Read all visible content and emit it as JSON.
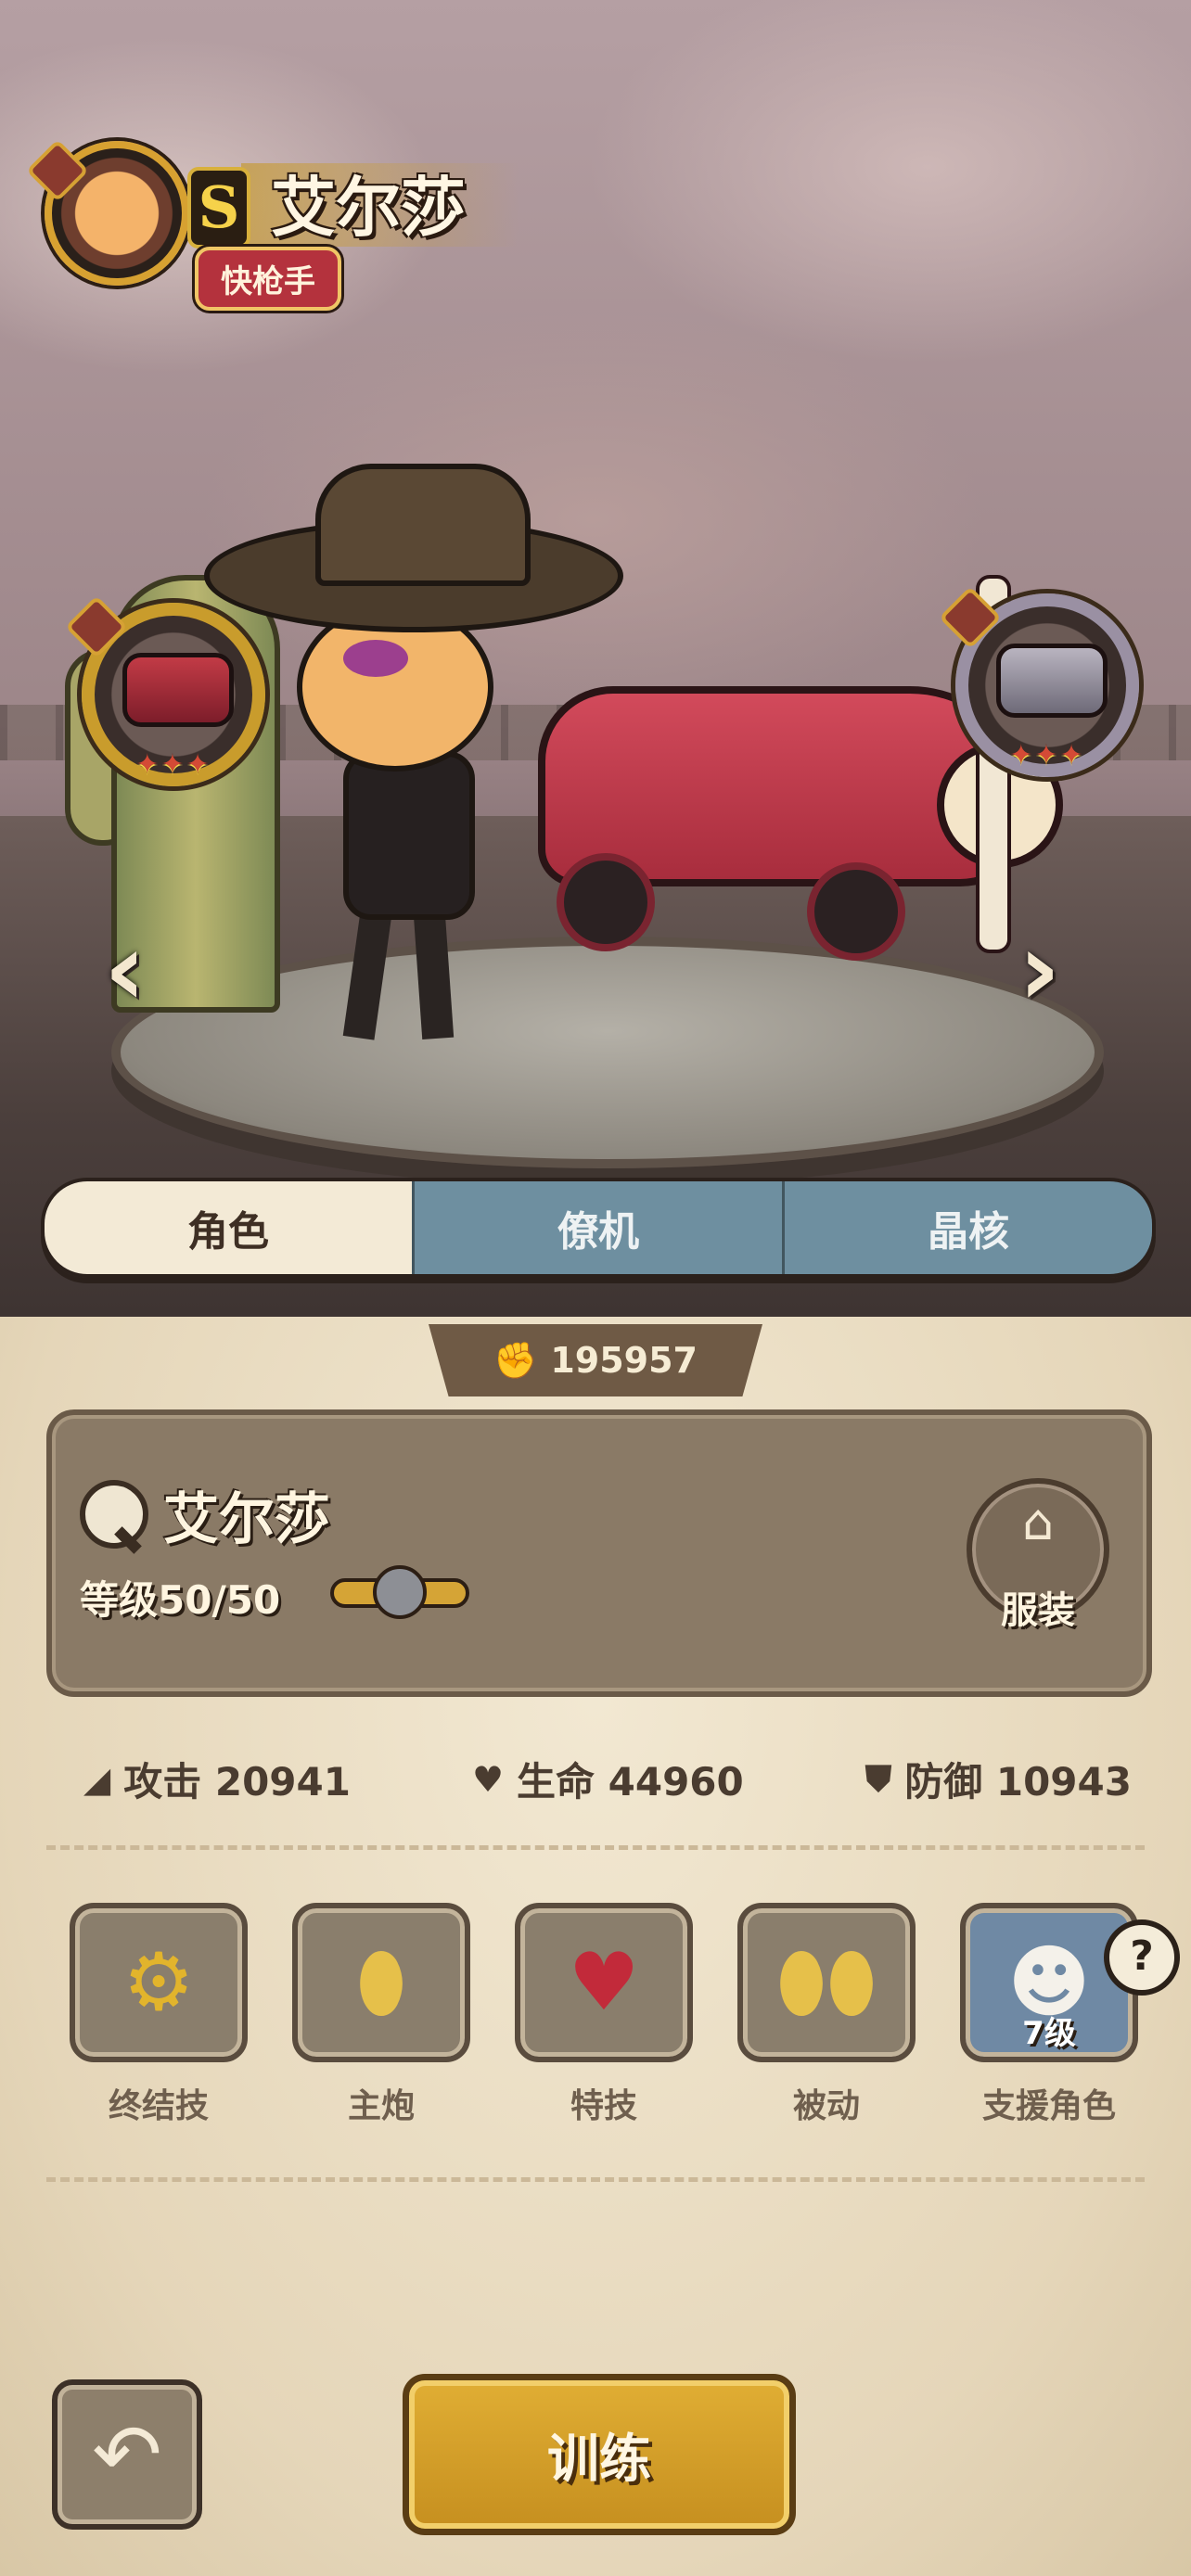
{
  "header": {
    "rank": "S",
    "name": "艾尔莎",
    "class": "快枪手"
  },
  "stage": {
    "prev_arrow": "‹",
    "next_arrow": "›",
    "left_equipment_stars": "✦✦✦",
    "right_equipment_stars": "✦✦✦"
  },
  "tabs": [
    {
      "label": "角色",
      "active": true
    },
    {
      "label": "僚机",
      "active": false
    },
    {
      "label": "晶核",
      "active": false
    }
  ],
  "power": {
    "value": "195957",
    "icon": "fist-icon"
  },
  "info": {
    "name": "艾尔莎",
    "level": "等级50/50",
    "outfit_label": "服装"
  },
  "stats": {
    "attack": "攻击 20941",
    "health": "生命 44960",
    "defense": "防御 10943"
  },
  "skills": [
    {
      "label": "终结技",
      "icon": "gatling-icon"
    },
    {
      "label": "主炮",
      "icon": "bullet-icon"
    },
    {
      "label": "特技",
      "icon": "heart-icon"
    },
    {
      "label": "被动",
      "icon": "double-bullet-icon"
    },
    {
      "label": "支援角色",
      "icon": "support-character-icon",
      "level": "7级"
    }
  ],
  "help_glyph": "?",
  "buttons": {
    "train": "训练",
    "back_icon": "↶"
  },
  "colors": {
    "accent_gold": "#d8a638",
    "tab_inactive": "#6e8fa0",
    "class_tag": "#b4323d"
  }
}
